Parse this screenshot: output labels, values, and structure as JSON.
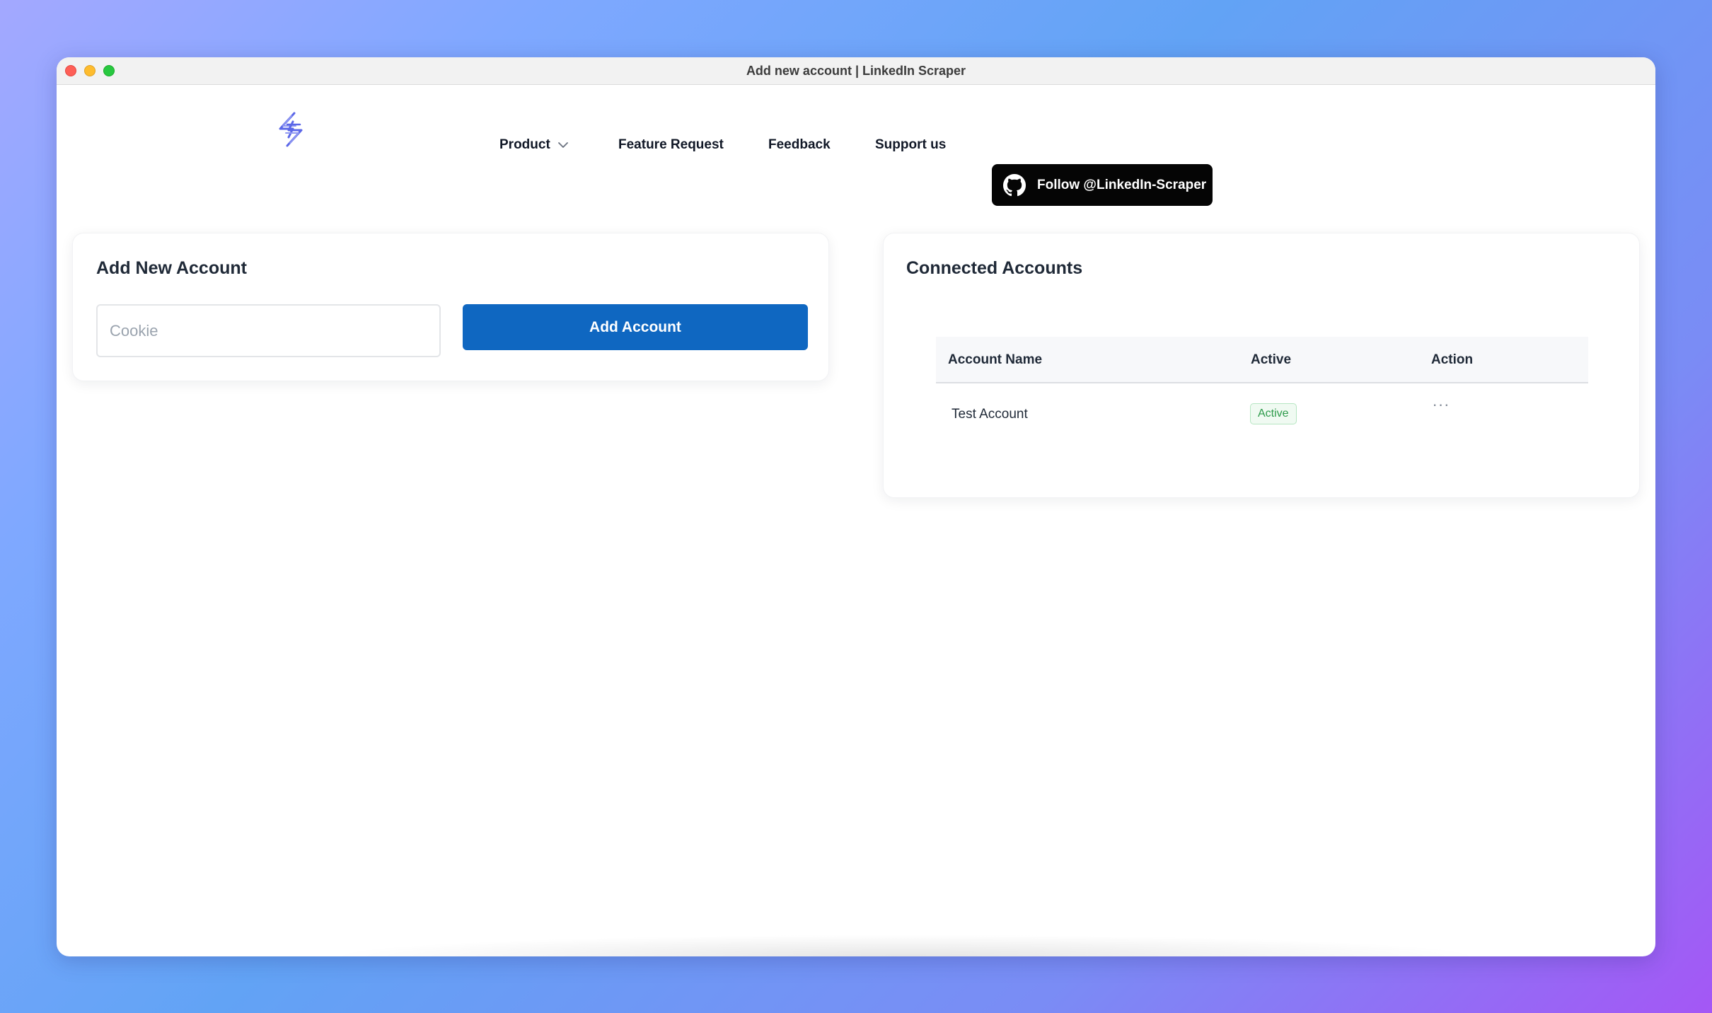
{
  "window": {
    "title": "Add new account | LinkedIn Scraper"
  },
  "nav": {
    "logo_icon": "lightning-s-logo-icon",
    "items": [
      {
        "label": "Product",
        "has_dropdown": true
      },
      {
        "label": "Feature Request"
      },
      {
        "label": "Feedback"
      },
      {
        "label": "Support us"
      }
    ],
    "github_button": {
      "label": "Follow @LinkedIn-Scraper",
      "icon": "github-icon"
    }
  },
  "add_account": {
    "title": "Add New Account",
    "cookie_placeholder": "Cookie",
    "cookie_value": "",
    "button_label": "Add Account"
  },
  "connected_accounts": {
    "title": "Connected Accounts",
    "columns": [
      "Account Name",
      "Active",
      "Action"
    ],
    "rows": [
      {
        "account_name": "Test Account",
        "status": "Active",
        "action_icon": "more-dots-icon"
      }
    ]
  },
  "colors": {
    "primary": "#0f67c1",
    "github_button_bg": "#050505",
    "badge_text": "#2c9a4a",
    "badge_bg": "#f0faf2"
  }
}
